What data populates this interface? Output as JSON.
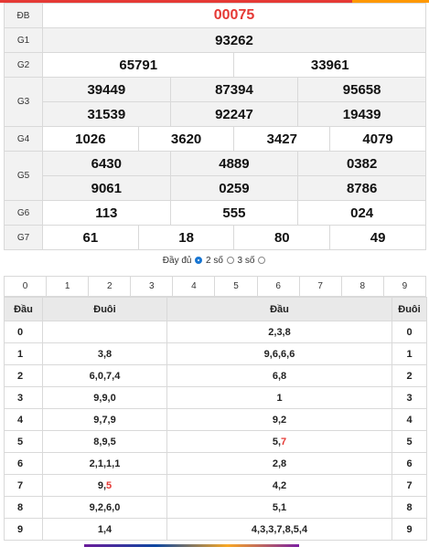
{
  "results": {
    "db": {
      "label": "ĐB",
      "value": "00075"
    },
    "g1": {
      "label": "G1",
      "values": [
        "93262"
      ]
    },
    "g2": {
      "label": "G2",
      "values": [
        "65791",
        "33961"
      ]
    },
    "g3": {
      "label": "G3",
      "values": [
        "39449",
        "87394",
        "95658",
        "31539",
        "92247",
        "19439"
      ]
    },
    "g4": {
      "label": "G4",
      "values": [
        "1026",
        "3620",
        "3427",
        "4079"
      ]
    },
    "g5": {
      "label": "G5",
      "values": [
        "6430",
        "4889",
        "0382",
        "9061",
        "0259",
        "8786"
      ]
    },
    "g6": {
      "label": "G6",
      "values": [
        "113",
        "555",
        "024"
      ]
    },
    "g7": {
      "label": "G7",
      "values": [
        "61",
        "18",
        "80",
        "49"
      ]
    }
  },
  "options": {
    "full": "Đầy đủ",
    "two": "2 số",
    "three": "3 số",
    "selected": "full"
  },
  "digits": [
    "0",
    "1",
    "2",
    "3",
    "4",
    "5",
    "6",
    "7",
    "8",
    "9"
  ],
  "dd_table": {
    "headers": [
      "Đầu",
      "Đuôi",
      "Đầu",
      "Đuôi"
    ],
    "rows": [
      {
        "left": "0",
        "duoi": "",
        "dau": "2,3,8",
        "right": "0"
      },
      {
        "left": "1",
        "duoi": "3,8",
        "dau": "9,6,6,6",
        "right": "1"
      },
      {
        "left": "2",
        "duoi": "6,0,7,4",
        "dau": "6,8",
        "right": "2"
      },
      {
        "left": "3",
        "duoi": "9,9,0",
        "dau": "1",
        "right": "3"
      },
      {
        "left": "4",
        "duoi": "9,7,9",
        "dau": "9,2",
        "right": "4"
      },
      {
        "left": "5",
        "duoi": "8,9,5",
        "dau_a": "5,",
        "dau_b": "7",
        "right": "5"
      },
      {
        "left": "6",
        "duoi": "2,1,1,1",
        "dau": "2,8",
        "right": "6"
      },
      {
        "left": "7",
        "duoi_a": "9,",
        "duoi_b": "5",
        "dau": "4,2",
        "right": "7"
      },
      {
        "left": "8",
        "duoi": "9,2,6,0",
        "dau": "5,1",
        "right": "8"
      },
      {
        "left": "9",
        "duoi": "1,4",
        "dau": "4,3,3,7,8,5,4",
        "right": "9"
      }
    ]
  }
}
